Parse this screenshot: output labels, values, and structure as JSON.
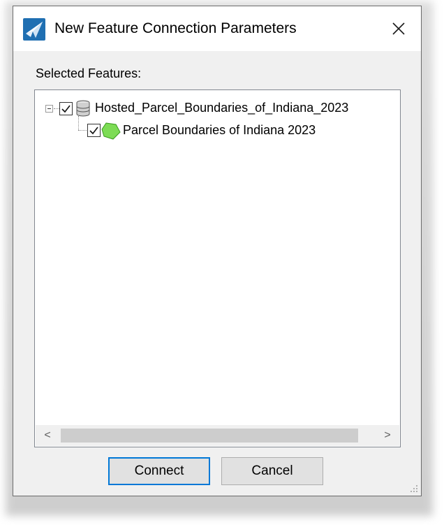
{
  "dialog": {
    "title": "New Feature Connection Parameters",
    "close_glyph": "✕",
    "section_label": "Selected Features:",
    "icons": {
      "app": "app-wing-icon",
      "close": "close-icon",
      "database": "database-icon",
      "polygon": "polygon-layer-icon"
    },
    "tree": {
      "root": {
        "label": "Hosted_Parcel_Boundaries_of_Indiana_2023",
        "checked": true,
        "expanded": true
      },
      "child": {
        "label": "Parcel Boundaries of Indiana 2023",
        "checked": true
      }
    },
    "scroll": {
      "left_glyph": "<",
      "right_glyph": ">"
    },
    "buttons": {
      "connect": "Connect",
      "cancel": "Cancel"
    },
    "colors": {
      "accent": "#0078d7",
      "polygon_fill": "#7ddc55"
    }
  }
}
